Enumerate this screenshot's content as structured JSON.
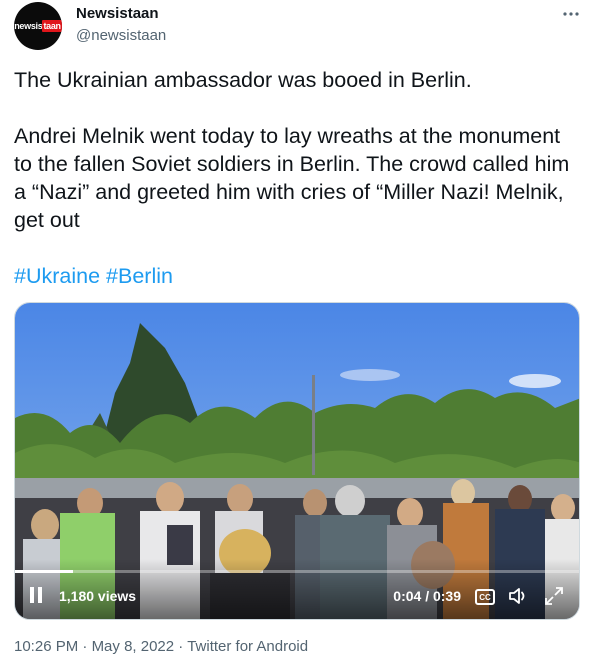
{
  "author": {
    "display_name": "Newsistaan",
    "handle": "@newsistaan",
    "avatar_text_white": "newsis",
    "avatar_text_red": "taan"
  },
  "tweet": {
    "line1": "The Ukrainian ambassador was booed in Berlin.",
    "line2": "Andrei Melnik went today to lay wreaths at the monument to the fallen Soviet soldiers in Berlin. The crowd called him a “Nazi” and greeted him with cries of “Miller Nazi! Melnik, get out",
    "hashtags": [
      "#Ukraine",
      "#Berlin"
    ]
  },
  "video": {
    "views": "1,180 views",
    "time": "0:04 / 0:39",
    "progress_fraction": 0.1026,
    "cc_label": "CC",
    "icons": [
      "pause-icon",
      "closed-captions-icon",
      "volume-icon",
      "fullscreen-icon"
    ]
  },
  "meta": {
    "time": "10:26 PM",
    "separator": "·",
    "date": "May 8, 2022",
    "source": "Twitter for Android"
  },
  "colors": {
    "link": "#1d9bf0",
    "secondary_text": "#536471",
    "primary_text": "#0f1419"
  }
}
